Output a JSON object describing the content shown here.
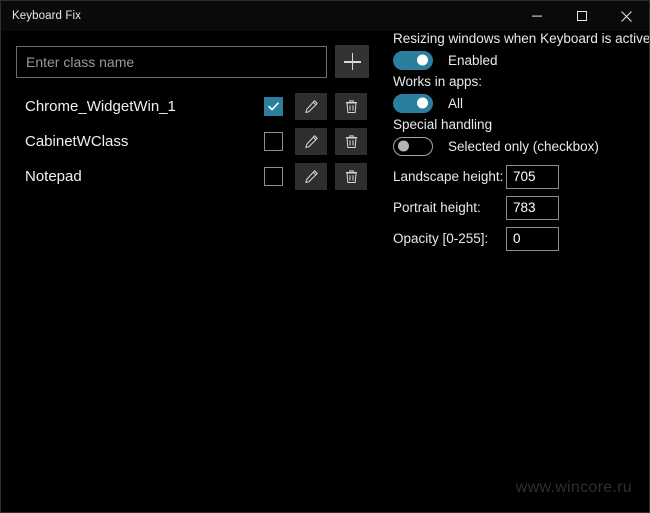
{
  "window": {
    "title": "Keyboard Fix",
    "controls": {
      "minimize": "minimize",
      "maximize": "maximize",
      "close": "close"
    }
  },
  "colors": {
    "background": "#000000",
    "titlebar": "#0a0a0a",
    "accent": "#2b7f9e",
    "button": "#2e2e2e",
    "text": "#e9e9e9",
    "border": "#8a8a8a",
    "watermark": "#2b2f31"
  },
  "left_pane": {
    "class_input": {
      "value": "",
      "placeholder": "Enter class name"
    },
    "add_button_label": "+",
    "rows": [
      {
        "name": "Chrome_WidgetWin_1",
        "checked": true,
        "edit_label": "edit",
        "delete_label": "delete"
      },
      {
        "name": "CabinetWClass",
        "checked": false,
        "edit_label": "edit",
        "delete_label": "delete"
      },
      {
        "name": "Notepad",
        "checked": false,
        "edit_label": "edit",
        "delete_label": "delete"
      }
    ]
  },
  "right_pane": {
    "resizing": {
      "heading": "Resizing windows when Keyboard is active",
      "toggle_label": "Enabled",
      "toggle_on": true
    },
    "works_in_apps": {
      "heading": "Works in apps:",
      "toggle_label": "All",
      "toggle_on": true
    },
    "special_handling": {
      "heading": "Special handling",
      "toggle_label": "Selected only (checkbox)",
      "toggle_on": false
    },
    "fields": [
      {
        "label": "Landscape height:",
        "value": "705"
      },
      {
        "label": "Portrait height:",
        "value": "783"
      },
      {
        "label": "Opacity [0-255]:",
        "value": "0"
      }
    ]
  },
  "watermark": "www.wincore.ru"
}
